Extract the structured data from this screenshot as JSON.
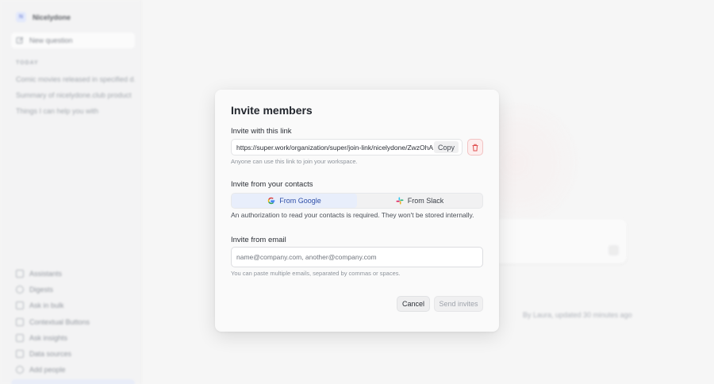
{
  "sidebar": {
    "brand_logo": "N",
    "brand_name": "Nicelydone",
    "new_question": "New question",
    "section_today": "TODAY",
    "history": [
      "Comic movies released in specified d...",
      "Summary of nicelydone.club product",
      "Things I can help you with"
    ],
    "nav": [
      {
        "label": "Assistants",
        "icon": "assistants-icon"
      },
      {
        "label": "Digests",
        "icon": "digests-icon"
      },
      {
        "label": "Ask in bulk",
        "icon": "ask-in-bulk-icon"
      },
      {
        "label": "Contextual Buttons",
        "icon": "contextual-buttons-icon"
      },
      {
        "label": "Ask insights",
        "icon": "ask-insights-icon"
      },
      {
        "label": "Data sources",
        "icon": "data-sources-icon"
      },
      {
        "label": "Add people",
        "icon": "add-people-icon"
      }
    ]
  },
  "main": {
    "updated_text": "By Laura, updated 30 minutes ago"
  },
  "modal": {
    "title": "Invite members",
    "link_section": {
      "label": "Invite with this link",
      "url": "https://super.work/organization/super/join-link/nicelydone/ZwzOhAu-",
      "copy_label": "Copy",
      "hint": "Anyone can use this link to join your workspace."
    },
    "contacts_section": {
      "label": "Invite from your contacts",
      "google_label": "From Google",
      "slack_label": "From Slack",
      "note": "An authorization to read your contacts is required. They won't be stored internally."
    },
    "email_section": {
      "label": "Invite from email",
      "placeholder": "name@company.com, another@company.com",
      "hint": "You can paste multiple emails, separated by commas or spaces."
    },
    "buttons": {
      "cancel": "Cancel",
      "send": "Send invites"
    },
    "colors": {
      "google_active_bg": "#e8eefb",
      "delete_red": "#e05252"
    }
  }
}
